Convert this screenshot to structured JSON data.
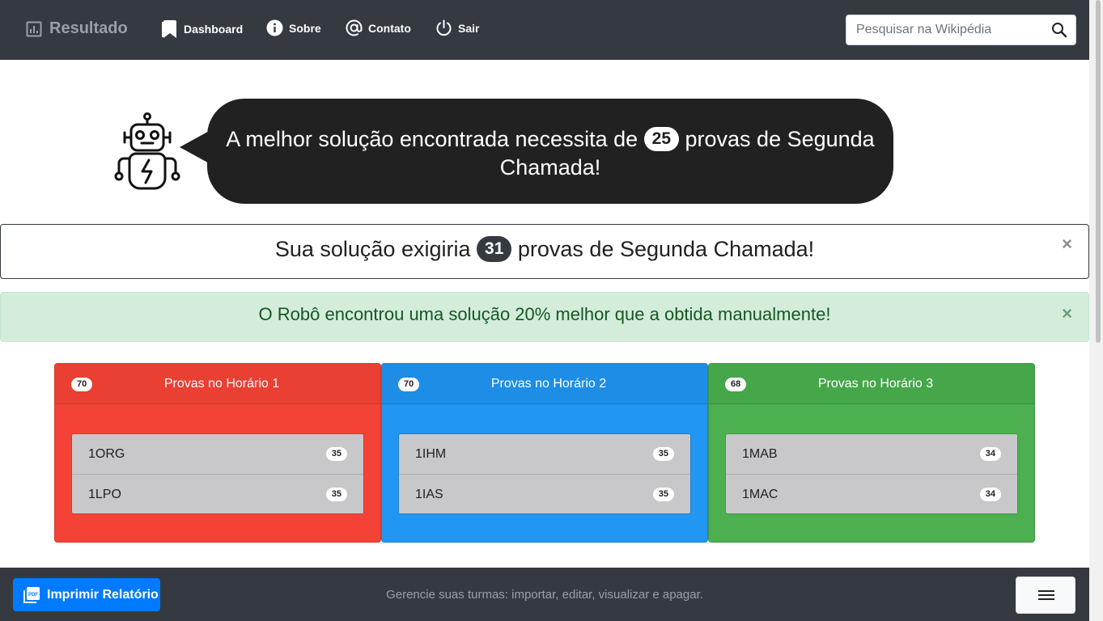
{
  "navbar": {
    "brand": "Resultado",
    "links": [
      {
        "label": "Dashboard",
        "icon": "bookmark-icon"
      },
      {
        "label": "Sobre",
        "icon": "info-icon"
      },
      {
        "label": "Contato",
        "icon": "at-sign-icon"
      },
      {
        "label": "Sair",
        "icon": "power-icon"
      }
    ],
    "search": {
      "placeholder": "Pesquisar na Wikipédia",
      "value": ""
    }
  },
  "robot_message": {
    "before": "A melhor solução encontrada necessita de",
    "count": "25",
    "after": "provas de Segunda Chamada!"
  },
  "user_solution": {
    "before": "Sua solução exigiria",
    "count": "31",
    "after": "provas de Segunda Chamada!",
    "close": "×"
  },
  "comparison": {
    "text": "O Robô encontrou uma solução 20% melhor que a obtida manualmente!",
    "close": "×"
  },
  "slots": [
    {
      "title": "Provas no Horário 1",
      "total": "70",
      "color": "#f44336",
      "items": [
        {
          "name": "1ORG",
          "count": "35"
        },
        {
          "name": "1LPO",
          "count": "35"
        }
      ]
    },
    {
      "title": "Provas no Horário 2",
      "total": "70",
      "color": "#2196f3",
      "items": [
        {
          "name": "1IHM",
          "count": "35"
        },
        {
          "name": "1IAS",
          "count": "35"
        }
      ]
    },
    {
      "title": "Provas no Horário 3",
      "total": "68",
      "color": "#4caf50",
      "items": [
        {
          "name": "1MAB",
          "count": "34"
        },
        {
          "name": "1MAC",
          "count": "34"
        }
      ]
    }
  ],
  "footer": {
    "print_label": "Imprimir Relatório",
    "text": "Gerencie suas turmas: importar, editar, visualizar e apagar."
  }
}
